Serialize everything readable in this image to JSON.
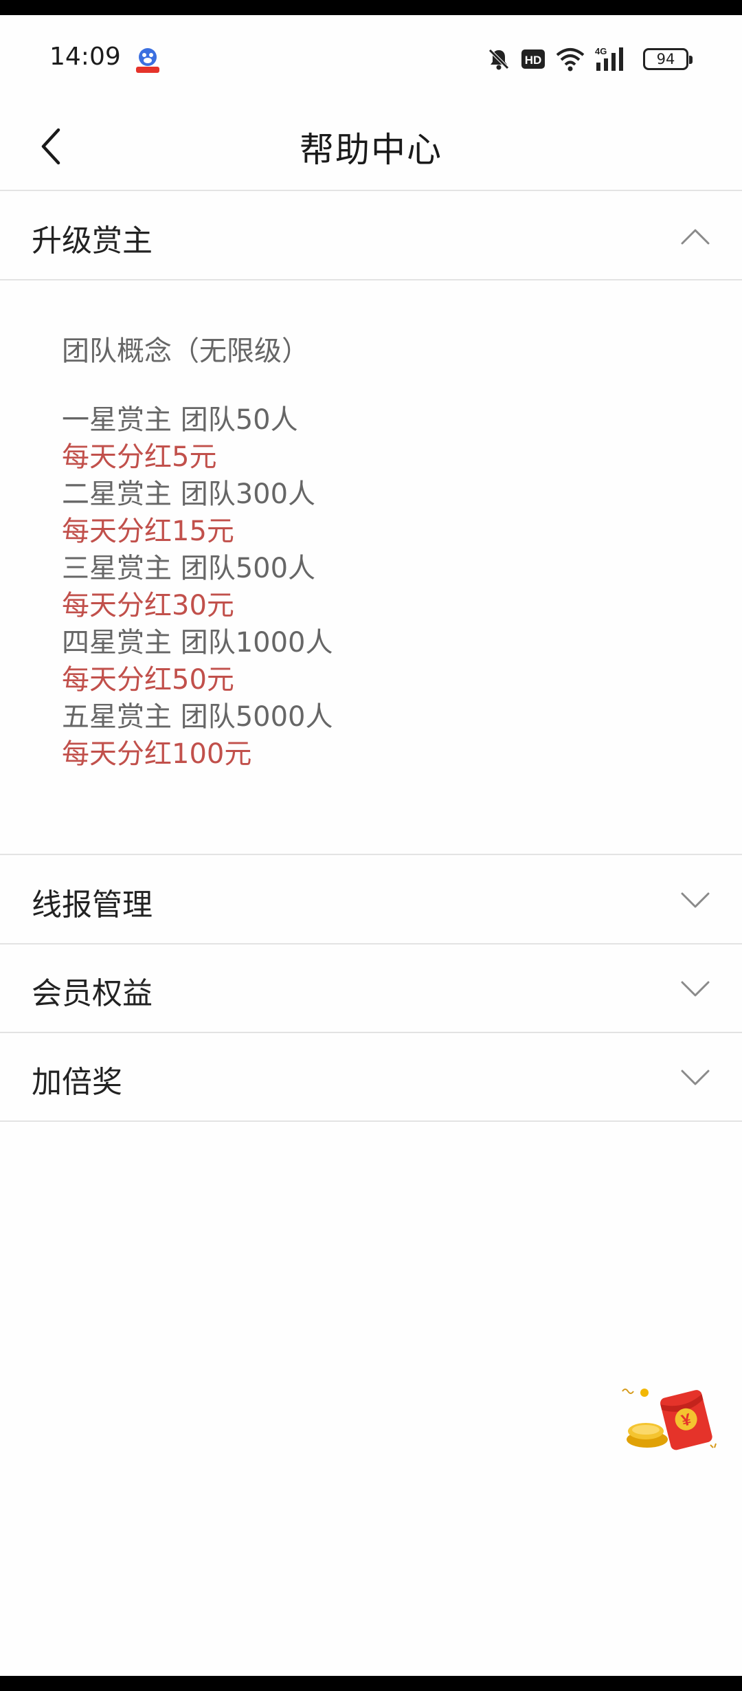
{
  "status_bar": {
    "time": "14:09",
    "battery": "94",
    "network": "4G",
    "hd_label": "HD",
    "icons": [
      "app-badge-icon",
      "bell-muted-icon",
      "hd-icon",
      "wifi-icon",
      "signal-4g-icon",
      "battery-icon"
    ]
  },
  "nav": {
    "title": "帮助中心",
    "back_icon": "chevron-left-icon"
  },
  "sections": [
    {
      "title": "升级赏主",
      "expanded": true,
      "chevron": "chevron-up-icon"
    },
    {
      "title": "线报管理",
      "expanded": false,
      "chevron": "chevron-down-icon"
    },
    {
      "title": "会员权益",
      "expanded": false,
      "chevron": "chevron-down-icon"
    },
    {
      "title": "加倍奖",
      "expanded": false,
      "chevron": "chevron-down-icon"
    }
  ],
  "content": {
    "concept": "团队概念（无限级）",
    "tiers": [
      {
        "tier": "一星赏主 团队50人",
        "bonus": "每天分红5元"
      },
      {
        "tier": "二星赏主 团队300人",
        "bonus": "每天分红15元"
      },
      {
        "tier": "三星赏主 团队500人",
        "bonus": "每天分红30元"
      },
      {
        "tier": "四星赏主 团队1000人",
        "bonus": "每天分红50元"
      },
      {
        "tier": "五星赏主 团队5000人",
        "bonus": "每天分红100元"
      }
    ]
  },
  "floating": {
    "icon": "red-packet-icon",
    "symbol": "¥"
  },
  "colors": {
    "background": "#fefefe",
    "divider": "#e3e3e3",
    "text_primary": "#222222",
    "text_secondary": "#666666",
    "bonus_red": "#c1504b",
    "packet_red": "#e5332a",
    "coin_gold": "#f2b705"
  }
}
